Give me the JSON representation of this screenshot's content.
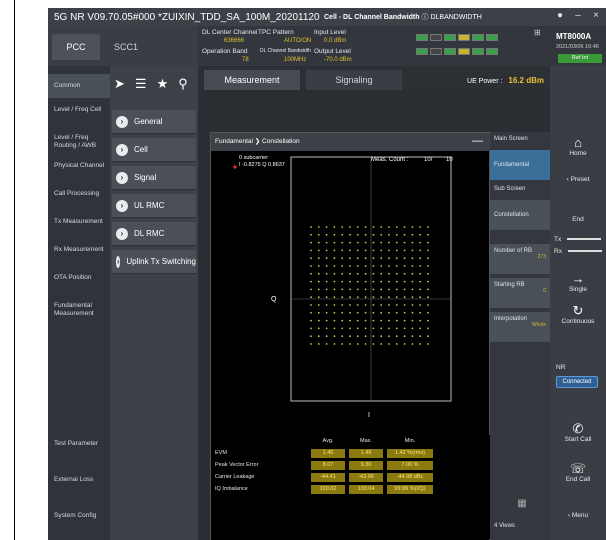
{
  "titlebar": {
    "app_title": "5G NR V09.70.05#000 *ZUIXIN_TDD_SA_100M_20201120",
    "center_bold": "Cell - DL Channel Bandwidth",
    "center_rest": "DLBANDWIDTH",
    "min_label": "–",
    "close_label": "×"
  },
  "carrier_tabs": {
    "pcc": "PCC",
    "scc1": "SCC1"
  },
  "header": {
    "dl_center_channel_label": "DL Center Channel",
    "dl_center_channel_value": "636666",
    "tpc_pattern_label": "TPC Pattern",
    "tpc_pattern_value": "AUTO/ON",
    "input_level_label": "Input Level",
    "input_level_value": "0.0 dBm",
    "operation_band_label": "Operation Band",
    "operation_band_value": "78",
    "dl_channel_bw_label": "DL Channel Bandwidth",
    "dl_channel_bw_value": "100MHz",
    "output_level_label": "Output Level",
    "output_level_value": "-70.0 dBm"
  },
  "instrument": {
    "model": "MT8000A",
    "date": "2021/03/06 16:46",
    "ref": "Ref Int"
  },
  "leftnav": {
    "common": "Common",
    "items": [
      "Level / Freq Cell",
      "Level / Freq Routing / AWB",
      "Physical Channel",
      "Call Processing",
      "Tx Measurement",
      "Rx Measurement",
      "OTA Position",
      "Fundamental Measurement",
      "Test Parameter",
      "External Loss",
      "System Config"
    ]
  },
  "funclist": [
    "General",
    "Cell",
    "Signal",
    "UL RMC",
    "DL RMC",
    "Uplink Tx Switching"
  ],
  "maintabs": {
    "measurement": "Measurement",
    "signaling": "Signaling"
  },
  "ue_power": {
    "label": "UE Power :",
    "value": "16.2 dBm"
  },
  "measurement": {
    "crumb_parent": "Fundamental",
    "crumb_child": "Constellation",
    "subcarrier": "0 subcarrier",
    "iq_readout": "I -0.8275 Q 0.8637",
    "meas_count_label": "Meas. Count :",
    "meas_count_value": "10/",
    "meas_count_total": "10",
    "axis_q": "Q",
    "axis_i": "I"
  },
  "results": {
    "col_avg": "Avg.",
    "col_max": "Max.",
    "col_min": "Min.",
    "rows": [
      {
        "name": "EVM",
        "avg": "1.45",
        "max": "1.49",
        "min": "1.42 %(rms)"
      },
      {
        "name": "Peak Vector Error",
        "avg": "8.07",
        "max": "9.30",
        "min": "7.00 %"
      },
      {
        "name": "Carrier Leakage",
        "avg": "-44.41",
        "max": "-43.96",
        "min": "-44.98 dBc"
      },
      {
        "name": "IQ Imbalance",
        "avg": "100.02",
        "max": "100.04",
        "min": "99.99 %(I/Q)"
      }
    ]
  },
  "sidepanel": {
    "main_screen": "Main Screen",
    "fundamental": "Fundamental",
    "sub_screen": "Sub Screen",
    "constellation": "Constellation",
    "number_of_rb": "Number of RB",
    "number_of_rb_value": "273",
    "starting_rb": "Starting RB",
    "starting_rb_value": "0",
    "interpolation": "Interpolation",
    "interpolation_value": "Whole",
    "views": "4 Views"
  },
  "softkeys": {
    "home": "Home",
    "preset": "Preset",
    "end": "End",
    "tx": "Tx",
    "rx": "Rx",
    "single": "Single",
    "continuous": "Continuous",
    "nr_label": "NR",
    "connected": "Connected",
    "start_call": "Start Call",
    "end_call": "End Call",
    "menu": "Menu"
  }
}
